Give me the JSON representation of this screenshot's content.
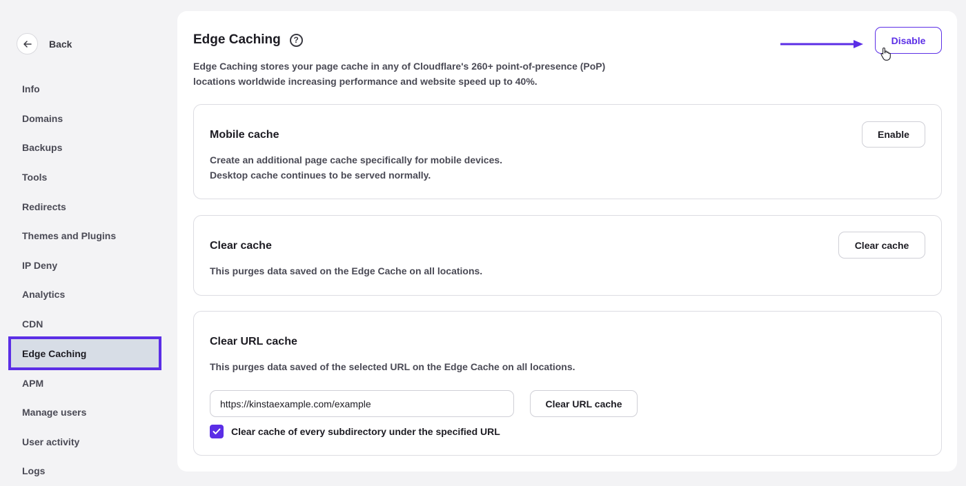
{
  "sidebar": {
    "back_label": "Back",
    "items": [
      {
        "label": "Info",
        "name": "sidebar-item-info"
      },
      {
        "label": "Domains",
        "name": "sidebar-item-domains"
      },
      {
        "label": "Backups",
        "name": "sidebar-item-backups"
      },
      {
        "label": "Tools",
        "name": "sidebar-item-tools"
      },
      {
        "label": "Redirects",
        "name": "sidebar-item-redirects"
      },
      {
        "label": "Themes and Plugins",
        "name": "sidebar-item-themes-and-plugins"
      },
      {
        "label": "IP Deny",
        "name": "sidebar-item-ip-deny"
      },
      {
        "label": "Analytics",
        "name": "sidebar-item-analytics"
      },
      {
        "label": "CDN",
        "name": "sidebar-item-cdn"
      },
      {
        "label": "Edge Caching",
        "name": "sidebar-item-edge-caching",
        "active": true
      },
      {
        "label": "APM",
        "name": "sidebar-item-apm"
      },
      {
        "label": "Manage users",
        "name": "sidebar-item-manage-users"
      },
      {
        "label": "User activity",
        "name": "sidebar-item-user-activity"
      },
      {
        "label": "Logs",
        "name": "sidebar-item-logs"
      }
    ]
  },
  "header": {
    "title": "Edge Caching",
    "help_glyph": "?",
    "intro_line1": "Edge Caching stores your page cache in any of Cloudflare's 260+ point-of-presence (PoP)",
    "intro_line2": "locations worldwide increasing performance and website speed up to 40%.",
    "disable_label": "Disable"
  },
  "mobile_cache": {
    "title": "Mobile cache",
    "desc_line1": "Create an additional page cache specifically for mobile devices.",
    "desc_line2": "Desktop cache continues to be served normally.",
    "button_label": "Enable"
  },
  "clear_cache": {
    "title": "Clear cache",
    "desc": "This purges data saved on the Edge Cache on all locations.",
    "button_label": "Clear cache"
  },
  "clear_url_cache": {
    "title": "Clear URL cache",
    "desc": "This purges data saved of the selected URL on the Edge Cache on all locations.",
    "url_value": "https://kinstaexample.com/example",
    "button_label": "Clear URL cache",
    "subdirectory_label": "Clear cache of every subdirectory under the specified URL",
    "subdirectory_checked": true
  },
  "colors": {
    "accent": "#5b2ee6",
    "active_bg": "#d7dde6"
  }
}
